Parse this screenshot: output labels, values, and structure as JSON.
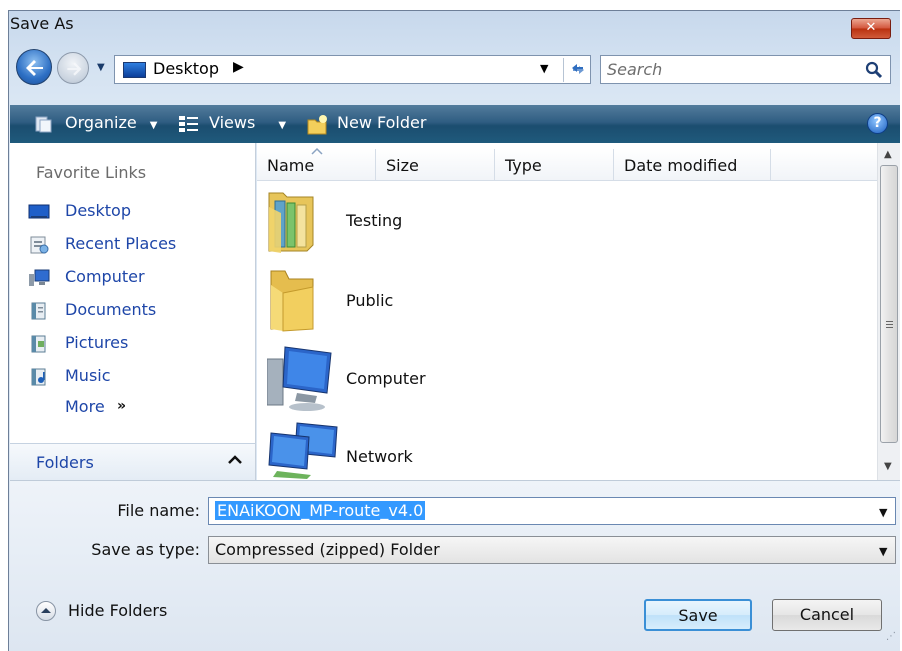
{
  "window": {
    "title": "Save As",
    "close_glyph": "✕"
  },
  "address": {
    "location": "Desktop",
    "separator": "▶",
    "dropdown_glyph": "▼",
    "refresh_glyph": "↻"
  },
  "search": {
    "placeholder": "Search"
  },
  "toolbar": {
    "organize_label": "Organize",
    "views_label": "Views",
    "new_folder_label": "New Folder",
    "dropdown_glyph": "▼",
    "help_glyph": "?"
  },
  "favorites": {
    "heading": "Favorite Links",
    "items": [
      {
        "label": "Desktop",
        "icon": "desktop-icon"
      },
      {
        "label": "Recent Places",
        "icon": "recent-places-icon"
      },
      {
        "label": "Computer",
        "icon": "computer-icon"
      },
      {
        "label": "Documents",
        "icon": "documents-icon"
      },
      {
        "label": "Pictures",
        "icon": "pictures-icon"
      },
      {
        "label": "Music",
        "icon": "music-icon"
      }
    ],
    "more_label": "More",
    "more_glyph": "»"
  },
  "folders_pane": {
    "label": "Folders"
  },
  "file_list": {
    "columns": [
      "Name",
      "Size",
      "Type",
      "Date modified"
    ],
    "items": [
      {
        "name": "Testing",
        "icon": "user-folder-icon"
      },
      {
        "name": "Public",
        "icon": "folder-icon"
      },
      {
        "name": "Computer",
        "icon": "computer-icon"
      },
      {
        "name": "Network",
        "icon": "network-icon"
      }
    ]
  },
  "form": {
    "file_name_label": "File name:",
    "file_name_value": "ENAiKOON_MP-route_v4.0",
    "save_type_label": "Save as type:",
    "save_type_value": "Compressed (zipped) Folder"
  },
  "footer": {
    "hide_folders_label": "Hide Folders",
    "save_label": "Save",
    "cancel_label": "Cancel"
  }
}
